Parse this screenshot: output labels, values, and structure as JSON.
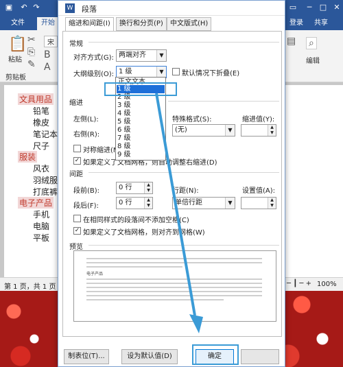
{
  "word": {
    "tabs": [
      "文件",
      "开始"
    ],
    "right_tabs": [
      "登录",
      "共享"
    ],
    "ribbon": {
      "paste": "粘贴",
      "clipboard": "剪贴板",
      "font_preview": "宋",
      "edit": "编辑"
    },
    "outline": [
      {
        "text": "文具用品",
        "level": "head"
      },
      {
        "text": "铅笔",
        "level": "item"
      },
      {
        "text": "橡皮",
        "level": "item"
      },
      {
        "text": "笔记本",
        "level": "item"
      },
      {
        "text": "尺子",
        "level": "item"
      },
      {
        "text": "服装",
        "level": "head"
      },
      {
        "text": "风衣",
        "level": "item"
      },
      {
        "text": "羽绒服",
        "level": "item"
      },
      {
        "text": "打底裤",
        "level": "item"
      },
      {
        "text": "电子产品",
        "level": "head"
      },
      {
        "text": "手机",
        "level": "item"
      },
      {
        "text": "电脑",
        "level": "item"
      },
      {
        "text": "平板",
        "level": "item"
      }
    ],
    "status": {
      "page": "第 1 页，共 1 页",
      "zoom": "100%"
    }
  },
  "dialog": {
    "title": "段落",
    "tabs": [
      "缩进和间距(I)",
      "换行和分页(P)",
      "中文版式(H)"
    ],
    "general": {
      "section": "常规",
      "alignment_label": "对齐方式(G):",
      "alignment_value": "两端对齐",
      "outline_label": "大纲级别(O):",
      "outline_value": "1 级",
      "collapse_label": "默认情况下折叠(E)"
    },
    "outline_options": [
      "正文文本",
      "1 级",
      "2 级",
      "3 级",
      "4 级",
      "5 级",
      "6 级",
      "7 级",
      "8 级",
      "9 级"
    ],
    "indent": {
      "section": "缩进",
      "left_label": "左侧(L):",
      "right_label": "右侧(R):",
      "special_label": "特殊格式(S):",
      "special_value": "(无)",
      "indent_value_label": "缩进值(Y):",
      "mirror_label": "对称缩进(M)",
      "auto_adjust_label": "如果定义了文档网格，则自动调整右缩进(D)"
    },
    "spacing": {
      "section": "间距",
      "before_label": "段前(B):",
      "before_value": "0 行",
      "after_label": "段后(F):",
      "after_value": "0 行",
      "line_label": "行距(N):",
      "line_value": "单倍行距",
      "setting_label": "设置值(A):",
      "no_space_label": "在相同样式的段落间不添加空格(C)",
      "snap_grid_label": "如果定义了文档网格，则对齐到网格(W)"
    },
    "preview": {
      "section": "预览",
      "sample_heading": "电子产品"
    },
    "buttons": {
      "tabs": "制表位(T)...",
      "default": "设为默认值(D)",
      "ok": "确定"
    }
  }
}
